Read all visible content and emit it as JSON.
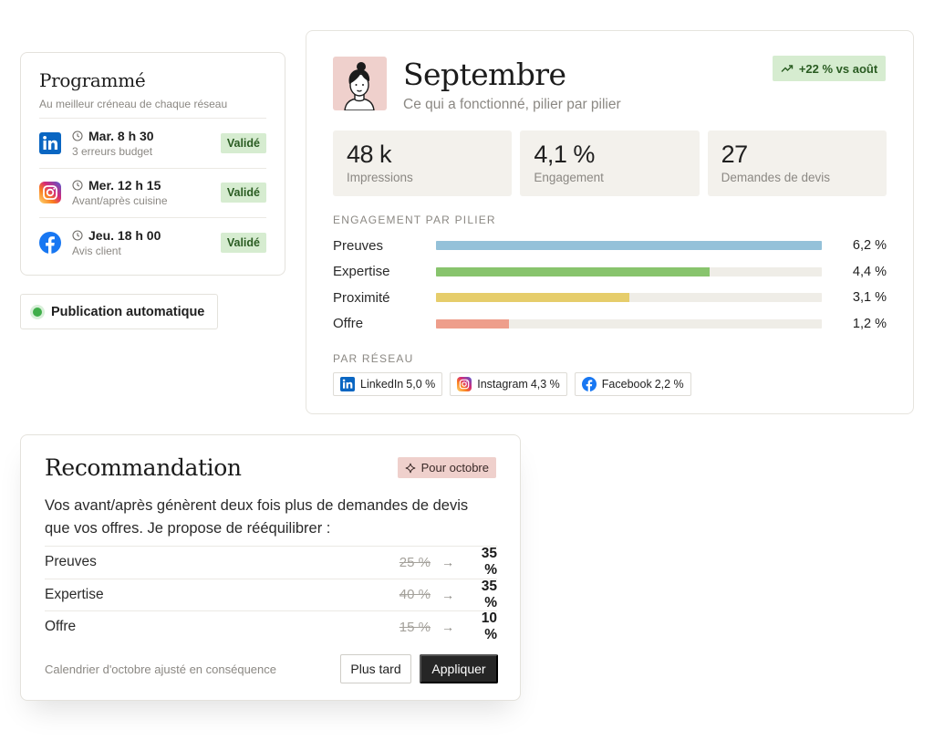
{
  "scheduled": {
    "title": "Programmé",
    "subtitle": "Au meilleur créneau de chaque réseau",
    "posts": [
      {
        "network": "linkedin-icon",
        "when": "Mar. 8 h 30",
        "desc": "3 erreurs budget",
        "status": "Validé"
      },
      {
        "network": "instagram-icon",
        "when": "Mer. 12 h 15",
        "desc": "Avant/après cuisine",
        "status": "Validé"
      },
      {
        "network": "facebook-icon",
        "when": "Jeu. 18 h 00",
        "desc": "Avis client",
        "status": "Validé"
      }
    ]
  },
  "auto_publish": {
    "label": "Publication automatique"
  },
  "report": {
    "title": "Septembre",
    "subtitle": "Ce qui a fonctionné, pilier par pilier",
    "trend": "+22 % vs août",
    "kpis": [
      {
        "value": "48 k",
        "label": "Impressions"
      },
      {
        "value": "4,1 %",
        "label": "Engagement"
      },
      {
        "value": "27",
        "label": "Demandes de devis"
      }
    ],
    "pillars_label": "ENGAGEMENT PAR PILIER",
    "pillars": [
      {
        "name": "Preuves",
        "value": "6,2 %",
        "fill": 1.0,
        "color": "#94c1d9"
      },
      {
        "name": "Expertise",
        "value": "4,4 %",
        "fill": 0.71,
        "color": "#88c46d"
      },
      {
        "name": "Proximité",
        "value": "3,1 %",
        "fill": 0.5,
        "color": "#e6cd6b"
      },
      {
        "name": "Offre",
        "value": "1,2 %",
        "fill": 0.19,
        "color": "#ee9e8b"
      }
    ],
    "networks_label": "PAR RÉSEAU",
    "networks": [
      {
        "icon": "linkedin-icon",
        "name": "LinkedIn",
        "value": "5,0 %"
      },
      {
        "icon": "instagram-icon",
        "name": "Instagram",
        "value": "4,3 %"
      },
      {
        "icon": "facebook-icon",
        "name": "Facebook",
        "value": "2,2 %"
      }
    ]
  },
  "recommendation": {
    "title": "Recommandation",
    "tag": "Pour octobre",
    "text": "Vos avant/après génèrent deux fois plus de demandes de devis que vos offres. Je propose de rééquilibrer :",
    "rows": [
      {
        "name": "Preuves",
        "old": "25 %",
        "new": "35 %"
      },
      {
        "name": "Expertise",
        "old": "40 %",
        "new": "35 %"
      },
      {
        "name": "Offre",
        "old": "15 %",
        "new": "10 %"
      }
    ],
    "footnote": "Calendrier d'octobre ajusté en conséquence",
    "later_label": "Plus tard",
    "apply_label": "Appliquer"
  },
  "colors": {
    "success_bg": "#d6ecd0",
    "accent_pink": "#efd0cc",
    "dark_button": "#262626"
  }
}
